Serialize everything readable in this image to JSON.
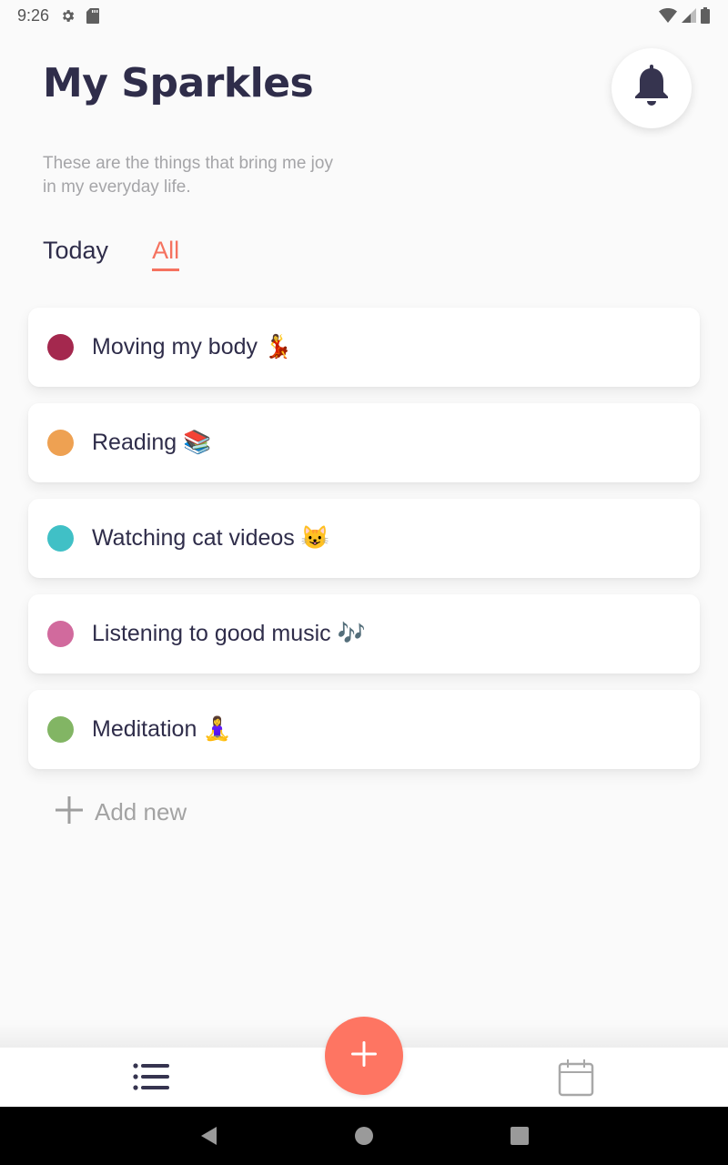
{
  "status_bar": {
    "time": "9:26",
    "left_icons": [
      "gear-icon",
      "sd-card-icon"
    ],
    "right_icons": [
      "wifi-icon",
      "cell-signal-icon",
      "battery-icon"
    ]
  },
  "header": {
    "title": "My Sparkles",
    "subtitle": "These are the things that bring me joy in my everyday life.",
    "notification_icon": "bell-icon"
  },
  "tabs": [
    {
      "label": "Today",
      "active": false
    },
    {
      "label": "All",
      "active": true
    }
  ],
  "sparkles": [
    {
      "label": "Moving my body 💃",
      "color": "#a4284e"
    },
    {
      "label": "Reading 📚",
      "color": "#eea152"
    },
    {
      "label": "Watching cat videos 😺",
      "color": "#40c0c6"
    },
    {
      "label": "Listening to good music 🎶",
      "color": "#d16a9d"
    },
    {
      "label": "Meditation 🧘‍♀️",
      "color": "#82b564"
    }
  ],
  "add_new": {
    "label": "Add new",
    "icon": "plus-icon"
  },
  "bottom_nav": {
    "items": [
      {
        "name": "list",
        "icon": "list-icon",
        "active": true
      },
      {
        "name": "calendar",
        "icon": "calendar-icon",
        "active": false
      }
    ],
    "fab_icon": "plus-icon"
  },
  "colors": {
    "accent": "#fe7562",
    "tab_active": "#f5725f",
    "text_primary": "#2f2d4a",
    "text_muted": "#a5a5a8"
  },
  "system_nav": [
    "back",
    "home",
    "recents"
  ]
}
